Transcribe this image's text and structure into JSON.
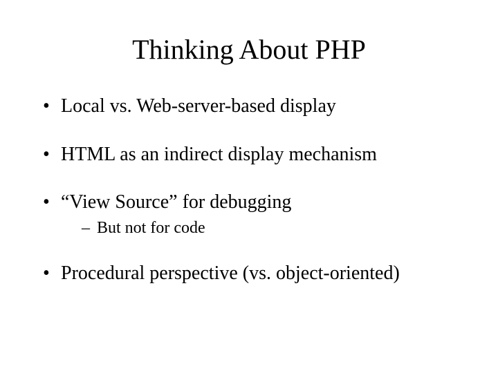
{
  "title": "Thinking About PHP",
  "bullets": [
    {
      "text": "Local vs. Web-server-based display"
    },
    {
      "text": "HTML as an indirect display mechanism"
    },
    {
      "text": "“View Source” for debugging",
      "sub": [
        "But not for code"
      ]
    },
    {
      "text": "Procedural perspective (vs. object-oriented)"
    }
  ]
}
